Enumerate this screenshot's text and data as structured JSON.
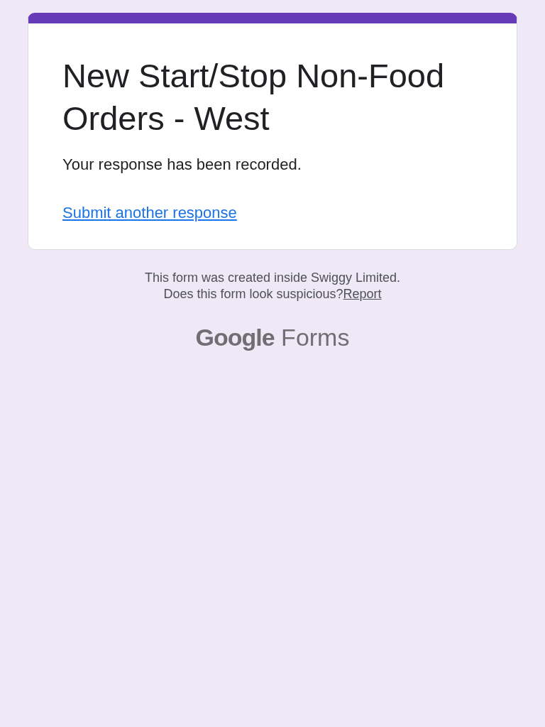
{
  "form": {
    "title": "New Start/Stop Non-Food Orders - West",
    "message": "Your response has been recorded.",
    "link": "Submit another response"
  },
  "footer": {
    "line_1": "This form was created inside Swiggy Limited.",
    "line_2": "Does this form look suspicious?",
    "report_link": "Report"
  },
  "logo": {
    "brand": "Google",
    "product": "Forms"
  }
}
